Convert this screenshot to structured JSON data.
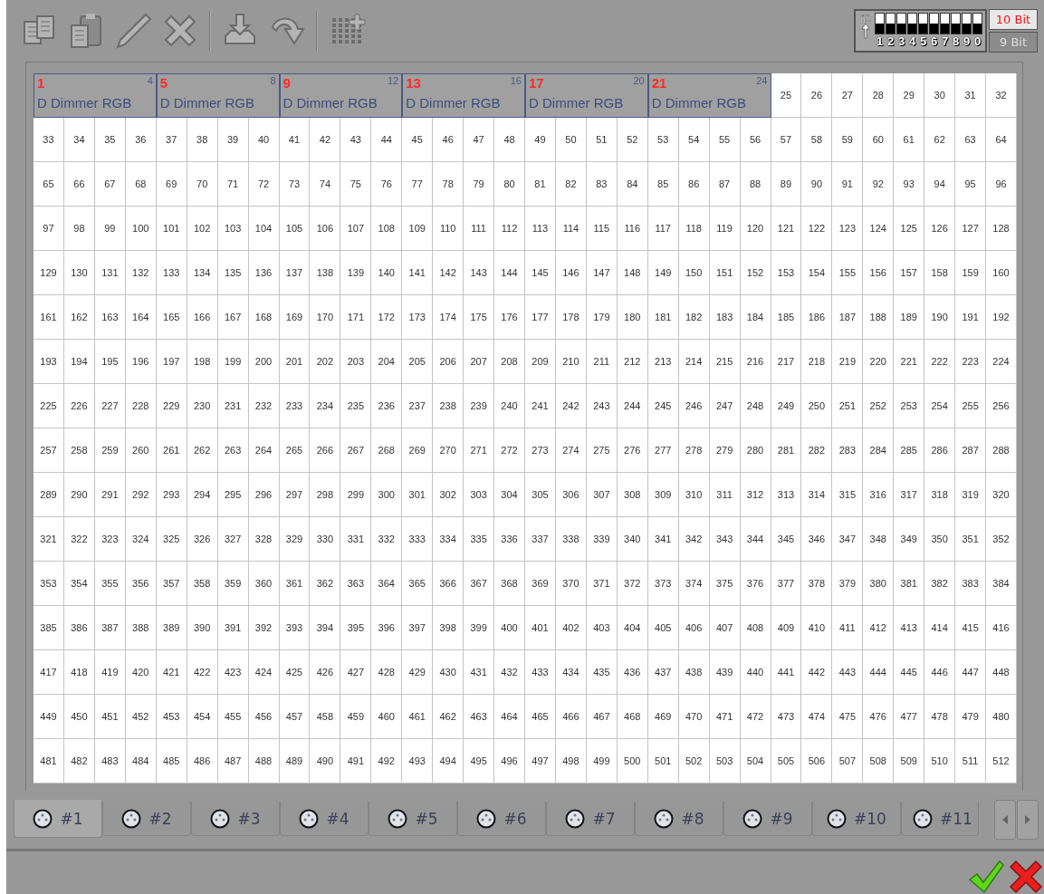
{
  "dip_switch": {
    "on_label": "on",
    "switches": [
      {
        "label": "1",
        "on": false
      },
      {
        "label": "2",
        "on": false
      },
      {
        "label": "3",
        "on": false
      },
      {
        "label": "4",
        "on": false
      },
      {
        "label": "5",
        "on": false
      },
      {
        "label": "6",
        "on": false
      },
      {
        "label": "7",
        "on": false
      },
      {
        "label": "8",
        "on": false
      },
      {
        "label": "9",
        "on": false
      },
      {
        "label": "0",
        "on": false
      }
    ]
  },
  "bit_modes": [
    {
      "label": "10 Bit",
      "selected": true
    },
    {
      "label": "9 Bit",
      "selected": false
    }
  ],
  "grid": {
    "fixtures": [
      {
        "start": "1",
        "end": "4",
        "name": "D Dimmer RGB"
      },
      {
        "start": "5",
        "end": "8",
        "name": "D Dimmer RGB"
      },
      {
        "start": "9",
        "end": "12",
        "name": "D Dimmer RGB"
      },
      {
        "start": "13",
        "end": "16",
        "name": "D Dimmer RGB"
      },
      {
        "start": "17",
        "end": "20",
        "name": "D Dimmer RGB"
      },
      {
        "start": "21",
        "end": "24",
        "name": "D Dimmer RGB"
      }
    ],
    "free_cells": [
      "25",
      "26",
      "27",
      "28",
      "29",
      "30",
      "31",
      "32"
    ],
    "rows": [
      [
        "33",
        "34",
        "35",
        "36",
        "37",
        "38",
        "39",
        "40",
        "41",
        "42",
        "43",
        "44",
        "45",
        "46",
        "47",
        "48",
        "49",
        "50",
        "51",
        "52",
        "53",
        "54",
        "55",
        "56",
        "57",
        "58",
        "59",
        "60",
        "61",
        "62",
        "63",
        "64"
      ],
      [
        "65",
        "66",
        "67",
        "68",
        "69",
        "70",
        "71",
        "72",
        "73",
        "74",
        "75",
        "76",
        "77",
        "78",
        "79",
        "80",
        "81",
        "82",
        "83",
        "84",
        "85",
        "86",
        "87",
        "88",
        "89",
        "90",
        "91",
        "92",
        "93",
        "94",
        "95",
        "96"
      ],
      [
        "97",
        "98",
        "99",
        "100",
        "101",
        "102",
        "103",
        "104",
        "105",
        "106",
        "107",
        "108",
        "109",
        "110",
        "111",
        "112",
        "113",
        "114",
        "115",
        "116",
        "117",
        "118",
        "119",
        "120",
        "121",
        "122",
        "123",
        "124",
        "125",
        "126",
        "127",
        "128"
      ],
      [
        "129",
        "130",
        "131",
        "132",
        "133",
        "134",
        "135",
        "136",
        "137",
        "138",
        "139",
        "140",
        "141",
        "142",
        "143",
        "144",
        "145",
        "146",
        "147",
        "148",
        "149",
        "150",
        "151",
        "152",
        "153",
        "154",
        "155",
        "156",
        "157",
        "158",
        "159",
        "160"
      ],
      [
        "161",
        "162",
        "163",
        "164",
        "165",
        "166",
        "167",
        "168",
        "169",
        "170",
        "171",
        "172",
        "173",
        "174",
        "175",
        "176",
        "177",
        "178",
        "179",
        "180",
        "181",
        "182",
        "183",
        "184",
        "185",
        "186",
        "187",
        "188",
        "189",
        "190",
        "191",
        "192"
      ],
      [
        "193",
        "194",
        "195",
        "196",
        "197",
        "198",
        "199",
        "200",
        "201",
        "202",
        "203",
        "204",
        "205",
        "206",
        "207",
        "208",
        "209",
        "210",
        "211",
        "212",
        "213",
        "214",
        "215",
        "216",
        "217",
        "218",
        "219",
        "220",
        "221",
        "222",
        "223",
        "224"
      ],
      [
        "225",
        "226",
        "227",
        "228",
        "229",
        "230",
        "231",
        "232",
        "233",
        "234",
        "235",
        "236",
        "237",
        "238",
        "239",
        "240",
        "241",
        "242",
        "243",
        "244",
        "245",
        "246",
        "247",
        "248",
        "249",
        "250",
        "251",
        "252",
        "253",
        "254",
        "255",
        "256"
      ],
      [
        "257",
        "258",
        "259",
        "260",
        "261",
        "262",
        "263",
        "264",
        "265",
        "266",
        "267",
        "268",
        "269",
        "270",
        "271",
        "272",
        "273",
        "274",
        "275",
        "276",
        "277",
        "278",
        "279",
        "280",
        "281",
        "282",
        "283",
        "284",
        "285",
        "286",
        "287",
        "288"
      ],
      [
        "289",
        "290",
        "291",
        "292",
        "293",
        "294",
        "295",
        "296",
        "297",
        "298",
        "299",
        "300",
        "301",
        "302",
        "303",
        "304",
        "305",
        "306",
        "307",
        "308",
        "309",
        "310",
        "311",
        "312",
        "313",
        "314",
        "315",
        "316",
        "317",
        "318",
        "319",
        "320"
      ],
      [
        "321",
        "322",
        "323",
        "324",
        "325",
        "326",
        "327",
        "328",
        "329",
        "330",
        "331",
        "332",
        "333",
        "334",
        "335",
        "336",
        "337",
        "338",
        "339",
        "340",
        "341",
        "342",
        "343",
        "344",
        "345",
        "346",
        "347",
        "348",
        "349",
        "350",
        "351",
        "352"
      ],
      [
        "353",
        "354",
        "355",
        "356",
        "357",
        "358",
        "359",
        "360",
        "361",
        "362",
        "363",
        "364",
        "365",
        "366",
        "367",
        "368",
        "369",
        "370",
        "371",
        "372",
        "373",
        "374",
        "375",
        "376",
        "377",
        "378",
        "379",
        "380",
        "381",
        "382",
        "383",
        "384"
      ],
      [
        "385",
        "386",
        "387",
        "388",
        "389",
        "390",
        "391",
        "392",
        "393",
        "394",
        "395",
        "396",
        "397",
        "398",
        "399",
        "400",
        "401",
        "402",
        "403",
        "404",
        "405",
        "406",
        "407",
        "408",
        "409",
        "410",
        "411",
        "412",
        "413",
        "414",
        "415",
        "416"
      ],
      [
        "417",
        "418",
        "419",
        "420",
        "421",
        "422",
        "423",
        "424",
        "425",
        "426",
        "427",
        "428",
        "429",
        "430",
        "431",
        "432",
        "433",
        "434",
        "435",
        "436",
        "437",
        "438",
        "439",
        "440",
        "441",
        "442",
        "443",
        "444",
        "445",
        "446",
        "447",
        "448"
      ],
      [
        "449",
        "450",
        "451",
        "452",
        "453",
        "454",
        "455",
        "456",
        "457",
        "458",
        "459",
        "460",
        "461",
        "462",
        "463",
        "464",
        "465",
        "466",
        "467",
        "468",
        "469",
        "470",
        "471",
        "472",
        "473",
        "474",
        "475",
        "476",
        "477",
        "478",
        "479",
        "480"
      ],
      [
        "481",
        "482",
        "483",
        "484",
        "485",
        "486",
        "487",
        "488",
        "489",
        "490",
        "491",
        "492",
        "493",
        "494",
        "495",
        "496",
        "497",
        "498",
        "499",
        "500",
        "501",
        "502",
        "503",
        "504",
        "505",
        "506",
        "507",
        "508",
        "509",
        "510",
        "511",
        "512"
      ]
    ]
  },
  "tabs": [
    {
      "label": "#1",
      "selected": true
    },
    {
      "label": "#2",
      "selected": false
    },
    {
      "label": "#3",
      "selected": false
    },
    {
      "label": "#4",
      "selected": false
    },
    {
      "label": "#5",
      "selected": false
    },
    {
      "label": "#6",
      "selected": false
    },
    {
      "label": "#7",
      "selected": false
    },
    {
      "label": "#8",
      "selected": false
    },
    {
      "label": "#9",
      "selected": false
    },
    {
      "label": "#10",
      "selected": false
    },
    {
      "label": "#11",
      "selected": false
    }
  ]
}
